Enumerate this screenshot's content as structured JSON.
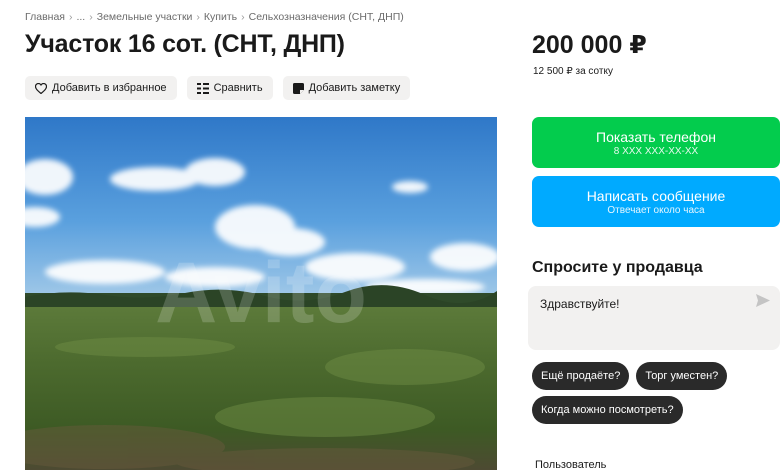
{
  "breadcrumb": {
    "items": [
      "Главная",
      "...",
      "Земельные участки",
      "Купить",
      "Сельхозназначения (СНТ, ДНП)"
    ],
    "separator": "›"
  },
  "listing": {
    "title": "Участок 16 сот. (СНТ, ДНП)"
  },
  "actions": {
    "favorite_label": "Добавить в избранное",
    "compare_label": "Сравнить",
    "note_label": "Добавить заметку"
  },
  "photo": {
    "watermark": "Avito"
  },
  "price": {
    "value": "200 000 ₽",
    "per_unit": "12 500 ₽ за сотку"
  },
  "contact": {
    "phone_label": "Показать телефон",
    "phone_number": "8 XXX XXX-XX-XX",
    "message_label": "Написать сообщение",
    "message_sub": "Отвечает около часа"
  },
  "ask_seller": {
    "title": "Спросите у продавца",
    "input_value": "Здравствуйте!",
    "quick_replies": [
      "Ещё продаёте?",
      "Торг уместен?",
      "Когда можно посмотреть?"
    ]
  },
  "seller": {
    "label": "Пользователь"
  },
  "colors": {
    "green": "#03cc4d",
    "blue": "#00aaff",
    "chip": "#2a2a2a",
    "button_bg": "#f2f1f0"
  },
  "icons": [
    "heart-icon",
    "compare-icon",
    "note-icon",
    "send-icon"
  ]
}
